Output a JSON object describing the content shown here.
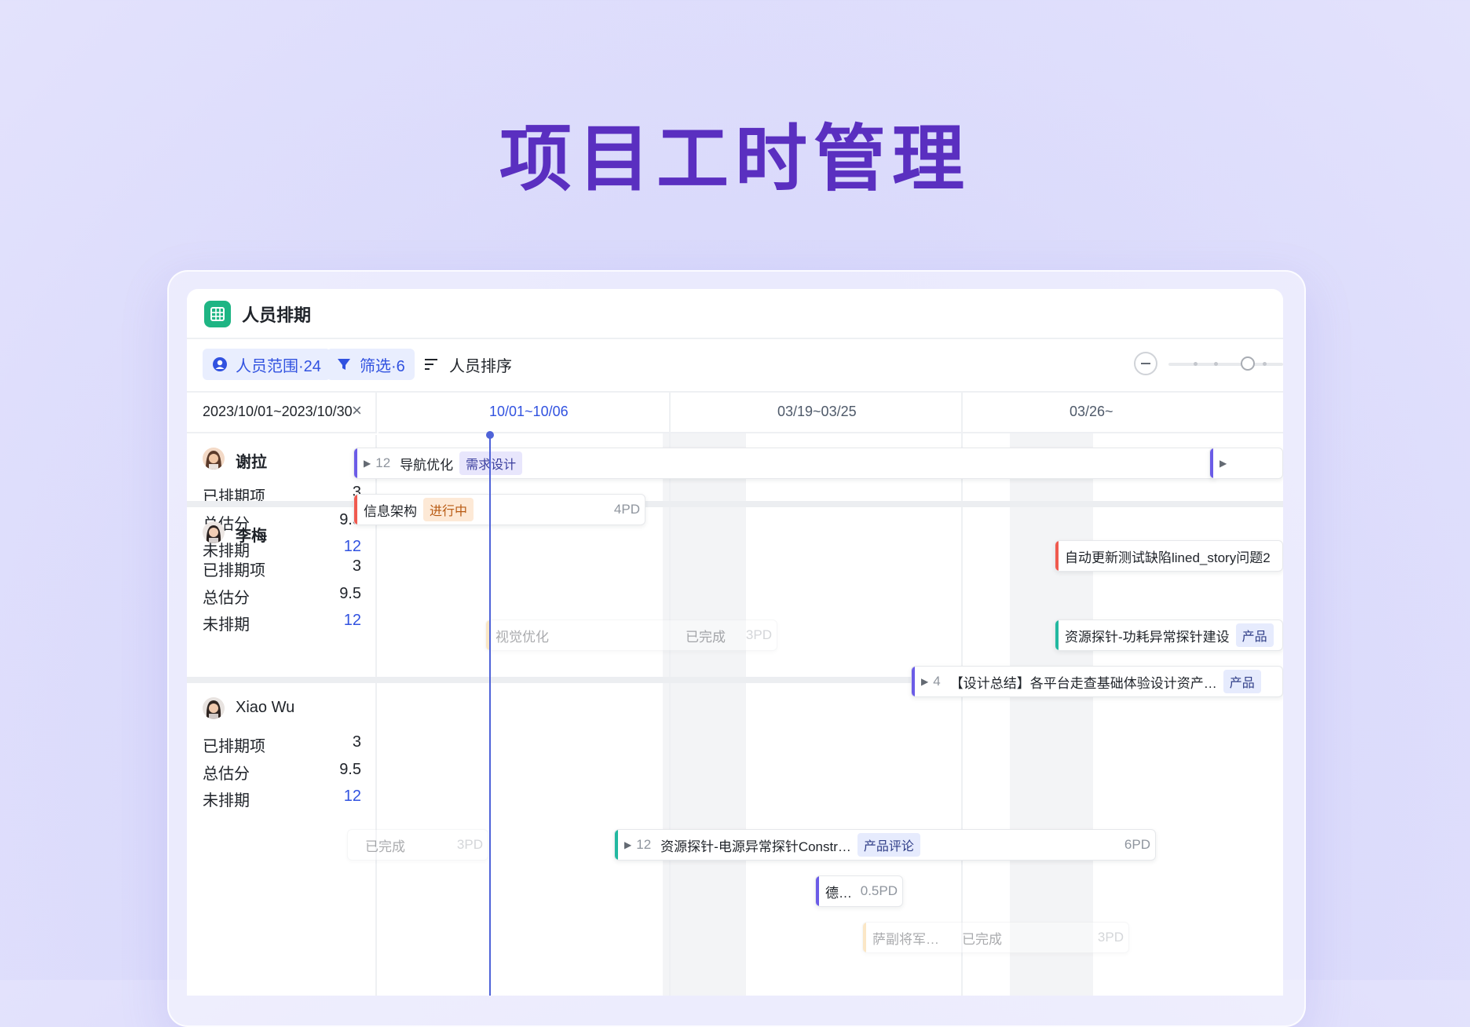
{
  "hero": {
    "title": "项目工时管理"
  },
  "app": {
    "name": "人员排期"
  },
  "toolbar": {
    "people_scope": "人员范围·24",
    "filter": "筛选·6",
    "sort": "人员排序"
  },
  "timeline": {
    "date_range": "2023/10/01~2023/10/30",
    "close": "×",
    "weeks": [
      "10/01~10/06",
      "03/19~03/25",
      "03/26~"
    ]
  },
  "labels": {
    "scheduled": "已排期项",
    "total_score": "总估分",
    "unscheduled": "未排期"
  },
  "people": [
    {
      "name": "谢拉",
      "scheduled": "3",
      "total_score": "9.5",
      "unscheduled": "12"
    },
    {
      "name": "李梅",
      "scheduled": "3",
      "total_score": "9.5",
      "unscheduled": "12"
    },
    {
      "name": "Xiao Wu",
      "scheduled": "3",
      "total_score": "9.5",
      "unscheduled": "12"
    }
  ],
  "tasks": {
    "t1": {
      "count": "12",
      "title": "导航优化",
      "tag": "需求设计"
    },
    "t2": {
      "title": "信息架构",
      "tag": "进行中",
      "pd": "4PD"
    },
    "t3": {
      "title": "自动更新测试缺陷lined_story问题2"
    },
    "t4": {
      "title": "视觉优化",
      "tag": "已完成",
      "pd": "3PD"
    },
    "t5": {
      "title": "资源探针-功耗异常探针建设",
      "tag": "产品"
    },
    "t6": {
      "count": "4",
      "title": "【设计总结】各平台走查基础体验设计资产…",
      "tag": "产品"
    },
    "t7": {
      "tag": "已完成",
      "pd": "3PD"
    },
    "t8": {
      "count": "12",
      "title": "资源探针-电源异常探针Constr…",
      "tag": "产品评论",
      "pd": "6PD"
    },
    "t9": {
      "title": "德…",
      "pd": "0.5PD"
    },
    "t10": {
      "title": "萨副将军…",
      "tag": "已完成",
      "pd": "3PD"
    }
  },
  "colors": {
    "accent": "#3152e0",
    "brand_green": "#1fb584",
    "hero_purple": "#5a2fc0",
    "bar_purple": "#6b5ce7",
    "bar_red": "#f05a4f",
    "bar_green": "#22b8a0"
  }
}
